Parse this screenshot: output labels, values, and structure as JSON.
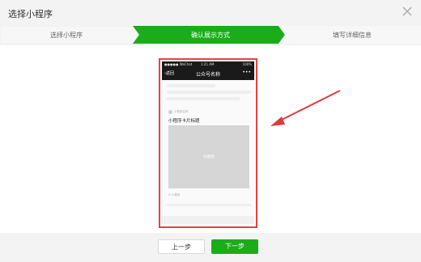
{
  "dialog": {
    "title": "选择小程序",
    "close_icon": "close-icon"
  },
  "steps": [
    {
      "label": "选择小程序",
      "state": "done"
    },
    {
      "label": "确认展示方式",
      "state": "active"
    },
    {
      "label": "填写详细信息",
      "state": "pending"
    }
  ],
  "colors": {
    "step_active": "#1aad19",
    "highlight_border": "#e04545",
    "primary_button": "#1aad19"
  },
  "phone": {
    "status_carrier": "●●●●● WeChat",
    "status_time": "1:21 AM",
    "status_battery": "100%",
    "back_label": "返回",
    "back_icon": "chevron-left-icon",
    "nav_title": "公众号名称",
    "more_icon": "more-icon",
    "card_source": "小程序名称",
    "card_title": "小程序卡片标题",
    "card_image_label": "标题图",
    "card_tag": "小程序"
  },
  "footer": {
    "prev_label": "上一步",
    "next_label": "下一步"
  }
}
